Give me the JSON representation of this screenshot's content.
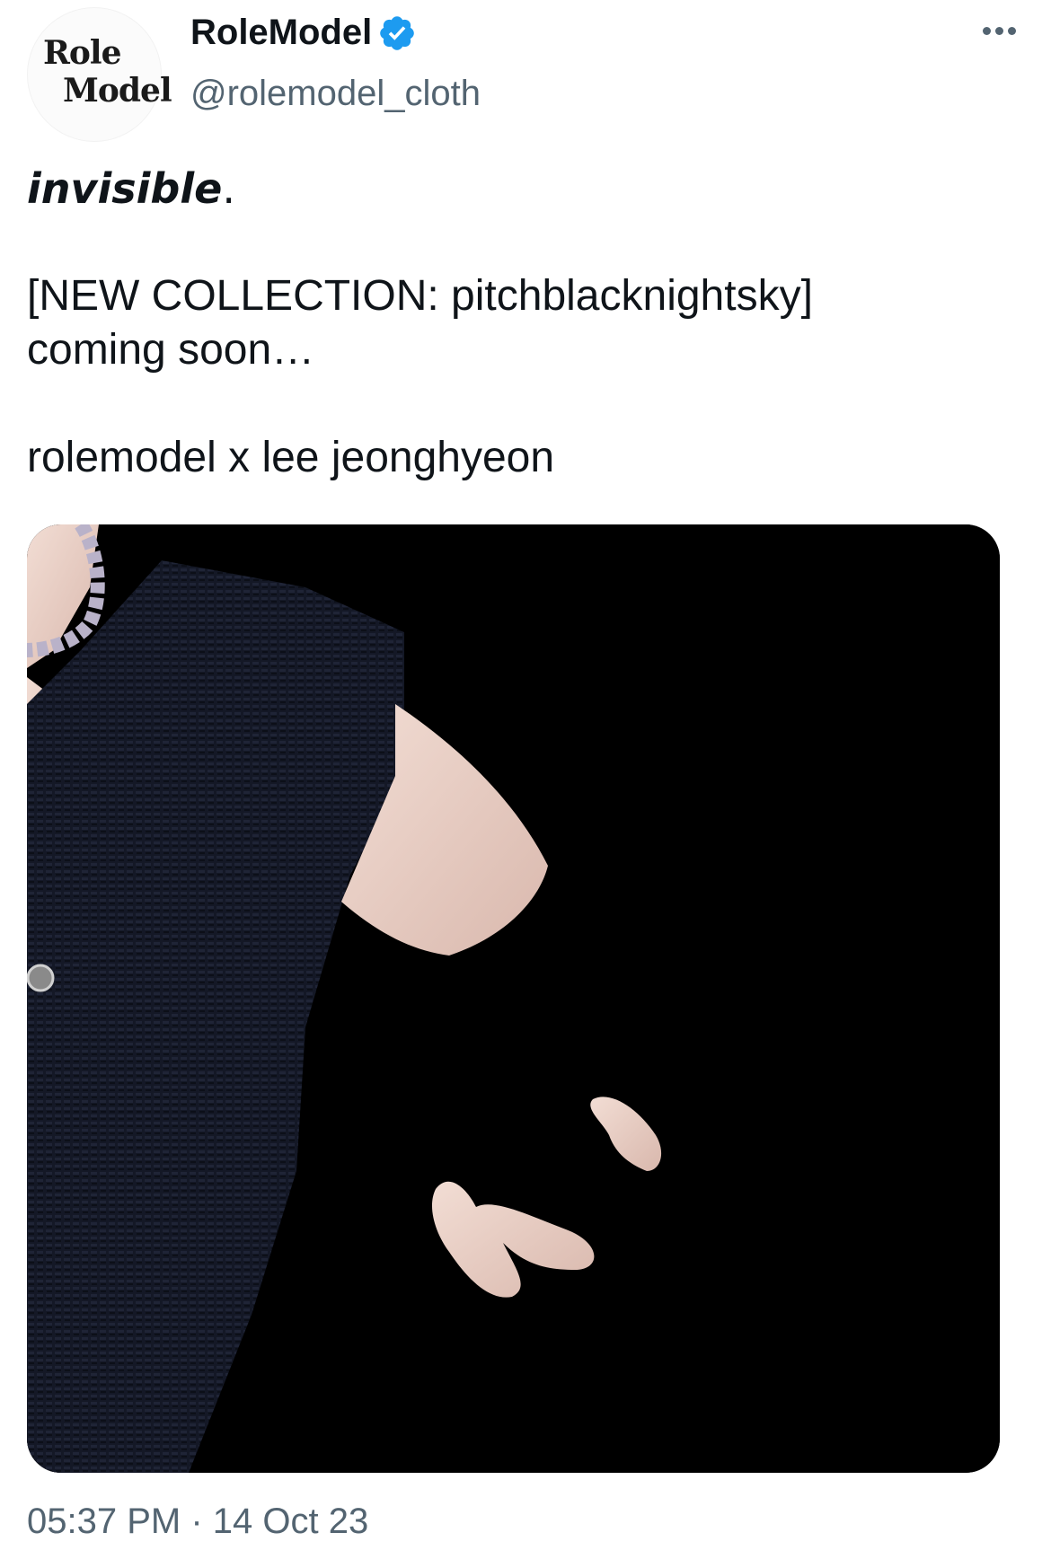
{
  "tweet": {
    "display_name": "RoleModel",
    "handle": "@rolemodel_cloth",
    "avatar_text_line1": "Role",
    "avatar_text_line2": "Model",
    "text_line1": "invisible",
    "text_line1_punct": ".",
    "text_line2": "[NEW COLLECTION: pitchblacknightsky]",
    "text_line3": "coming soon…",
    "text_line4": "rolemodel x lee jeonghyeon",
    "timestamp": "05:37 PM · 14 Oct 23"
  },
  "icons": {
    "verified": "verified-badge-icon",
    "more": "more-options-icon"
  },
  "colors": {
    "verified_blue": "#1d9bf0",
    "secondary_text": "#536471",
    "primary_text": "#0f1419"
  }
}
